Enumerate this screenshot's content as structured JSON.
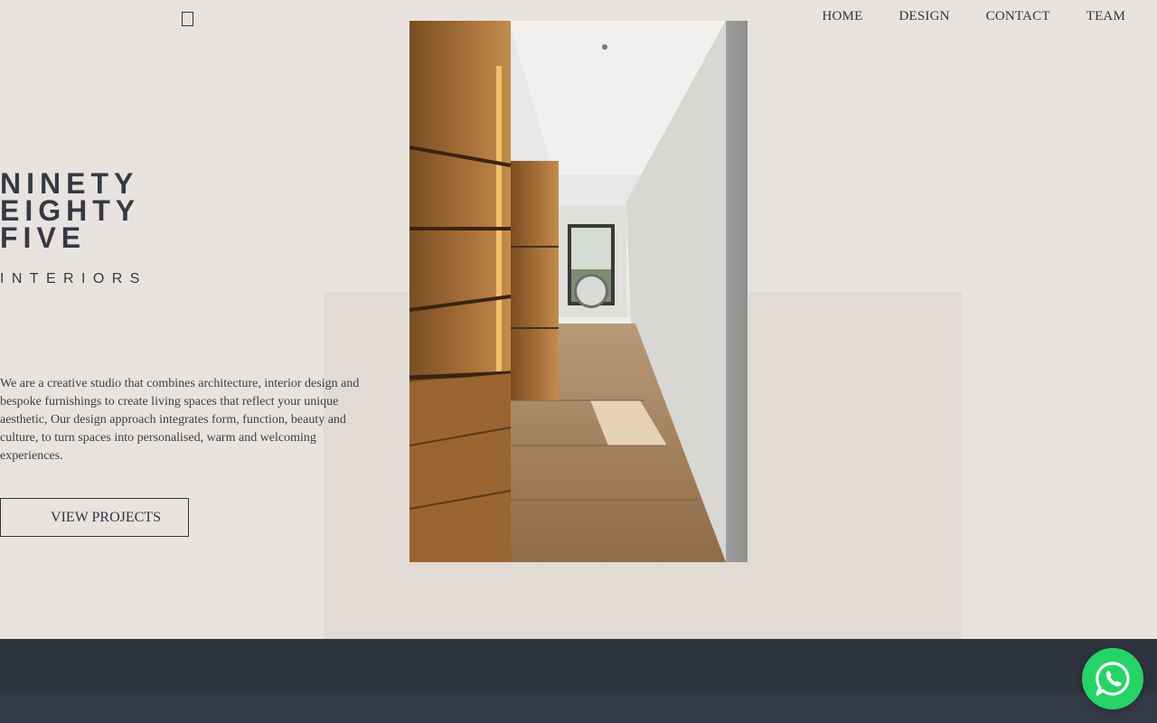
{
  "nav": {
    "items": [
      {
        "label": "HOME"
      },
      {
        "label": "DESIGN"
      },
      {
        "label": "CONTACT"
      },
      {
        "label": "TEAM"
      }
    ]
  },
  "logo": {
    "line1": "NINETY",
    "line2": "EIGHTY",
    "line3": "FIVE",
    "subtitle": "INTERIORS"
  },
  "intro": {
    "text": "We are a creative studio that combines architecture, interior design and bespoke furnishings to create living spaces that reflect your unique aesthetic, Our design approach integrates form, function, beauty and culture, to turn spaces into personalised, warm and welcoming experiences."
  },
  "cta": {
    "label": "VIEW PROJECTS"
  },
  "icons": {
    "menu": "menu-icon",
    "whatsapp": "whatsapp-icon"
  },
  "colors": {
    "background": "#e8e3df",
    "panel": "#e2dbd5",
    "text": "#2f3540",
    "footer": "#2e343e",
    "whatsapp": "#25d366"
  }
}
